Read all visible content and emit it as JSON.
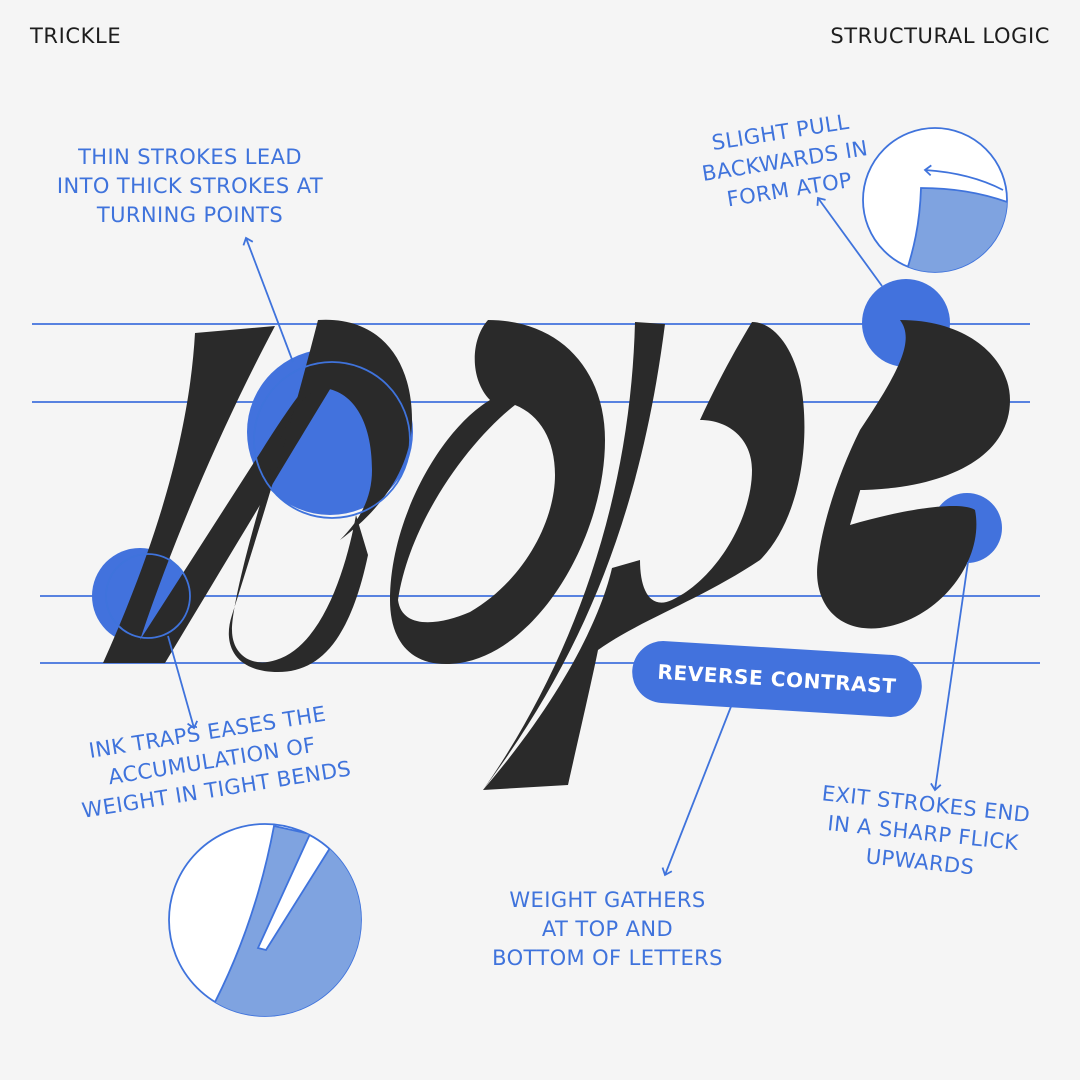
{
  "header": {
    "left": "TRICKLE",
    "right": "STRUCTURAL LOGIC"
  },
  "annotations": {
    "thin_strokes": [
      "THIN STROKES LEAD",
      "INTO THICK STROKES AT",
      "TURNING POINTS"
    ],
    "slight_pull": [
      "SLIGHT PULL",
      "BACKWARDS IN",
      "FORM ATOP"
    ],
    "ink_traps": [
      "INK TRAPS EASES THE",
      "ACCUMULATION OF",
      "WEIGHT IN TIGHT BENDS"
    ],
    "exit_strokes": [
      "EXIT STROKES END",
      "IN A SHARP FLICK",
      "UPWARDS"
    ],
    "weight_gathers": [
      "WEIGHT GATHERS",
      "AT TOP AND",
      "BOTTOM OF LETTERS"
    ]
  },
  "badge": {
    "label": "REVERSE CONTRAST"
  },
  "colors": {
    "background": "#f5f5f5",
    "accent_blue": "#4272dd",
    "light_blue": "#7fa3e0",
    "letterform": "#2a2a2a",
    "header_text": "#1d1d1d"
  }
}
